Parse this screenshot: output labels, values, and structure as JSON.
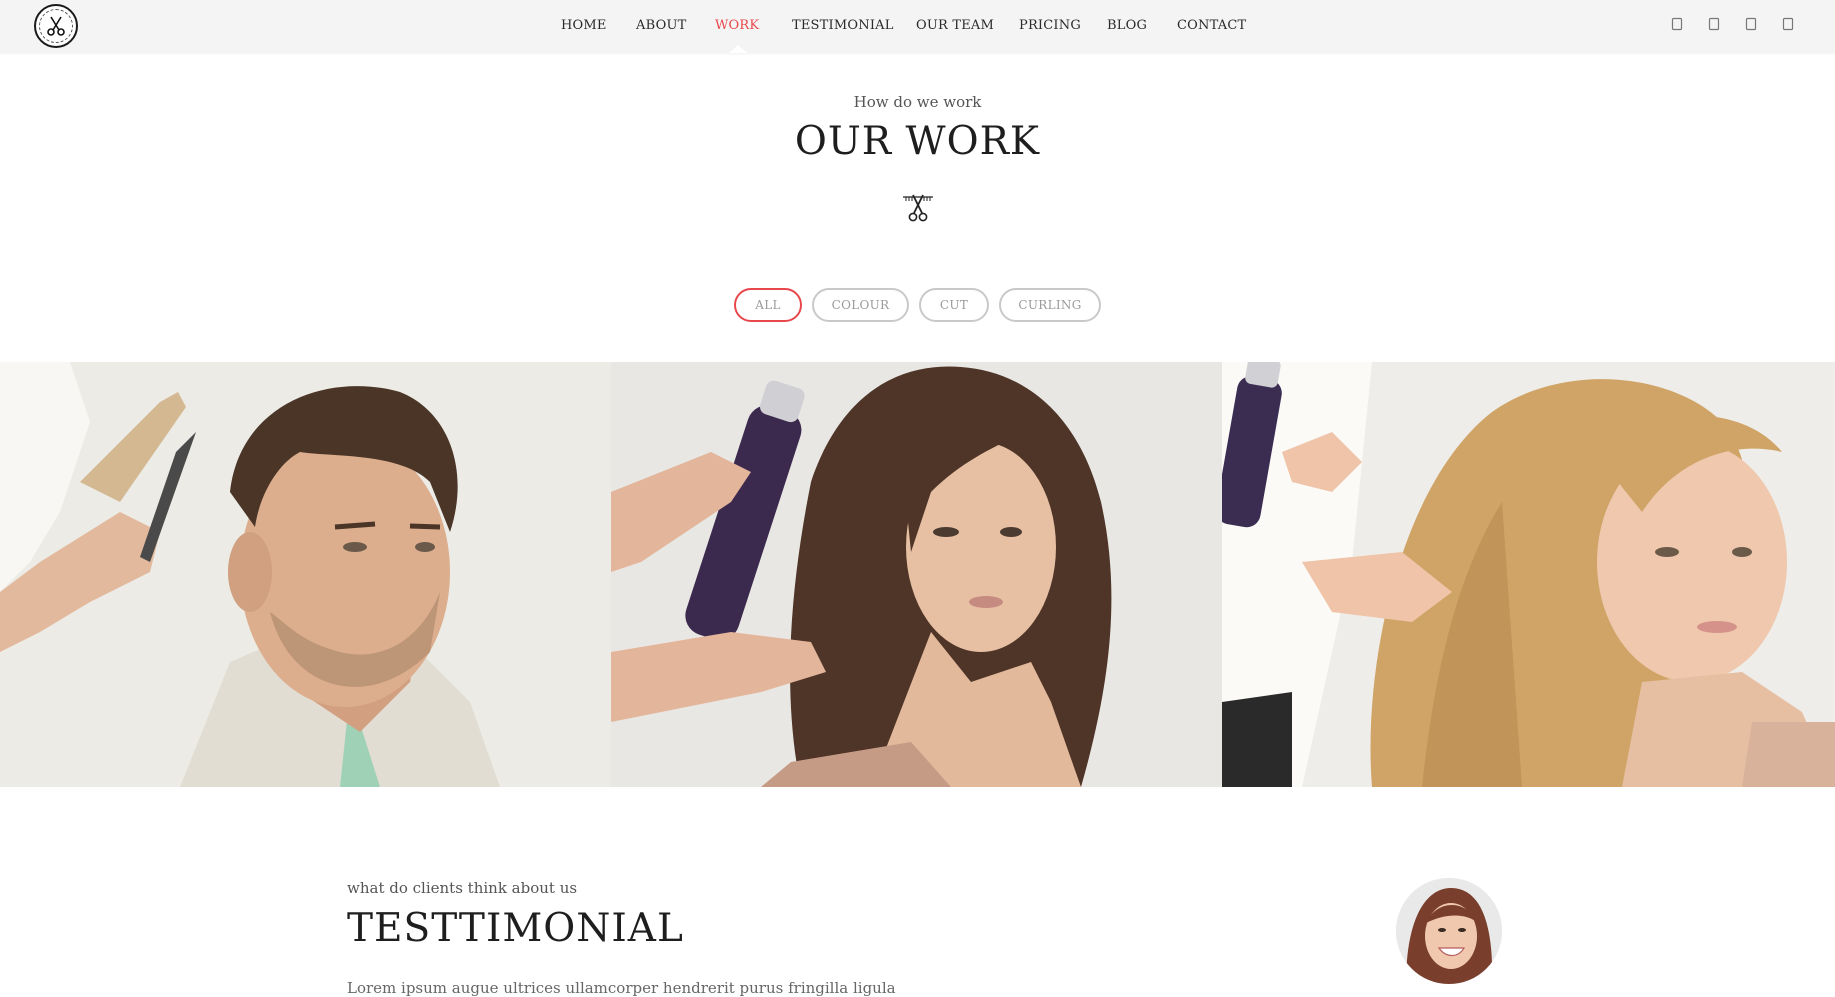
{
  "header": {
    "logo": "scissors-comb-logo",
    "nav": [
      {
        "label": "HOME",
        "active": false
      },
      {
        "label": "ABOUT",
        "active": false
      },
      {
        "label": "WORK",
        "active": true
      },
      {
        "label": "TESTIMONIAL",
        "active": false
      },
      {
        "label": "OUR TEAM",
        "active": false
      },
      {
        "label": "PRICING",
        "active": false
      },
      {
        "label": "BLOG",
        "active": false
      },
      {
        "label": "CONTACT",
        "active": false
      }
    ],
    "social_icons": [
      "facebook-icon",
      "twitter-icon",
      "google-plus-icon",
      "pinterest-icon"
    ]
  },
  "work": {
    "subtitle": "How do we work",
    "title": "OUR WORK",
    "divider_icon": "scissors-icon",
    "filters": [
      {
        "label": "ALL",
        "active": true
      },
      {
        "label": "COLOUR",
        "active": false
      },
      {
        "label": "CUT",
        "active": false
      },
      {
        "label": "CURLING",
        "active": false
      }
    ],
    "gallery": [
      {
        "icon": "man-haircut-photo"
      },
      {
        "icon": "woman-curls-photo"
      },
      {
        "icon": "woman-blonde-photo"
      }
    ]
  },
  "testimonial": {
    "subtitle": "what do clients think about us",
    "title": "TESTTIMONIAL",
    "text": "Lorem ipsum augue ultrices ullamcorper hendrerit purus fringilla ligula",
    "avatar_icon": "client-avatar-photo"
  },
  "colors": {
    "accent": "#e8474c",
    "header_bg": "#f4f4f4",
    "text_dark": "#1e1e1e"
  }
}
